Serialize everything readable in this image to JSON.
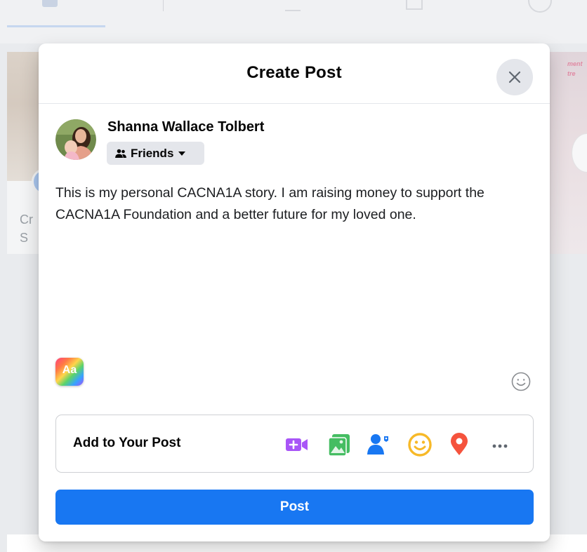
{
  "modal": {
    "title": "Create Post",
    "close_icon": "close-icon"
  },
  "author": {
    "name": "Shanna Wallace Tolbert",
    "avatar_icon": "profile-photo"
  },
  "audience": {
    "label": "Friends",
    "icon": "friends-icon",
    "caret_icon": "caret-down-icon"
  },
  "post": {
    "text": "This is my personal CACNA1A story. I am raising money to support the CACNA1A Foundation and a better future for my loved one.",
    "text_style_label": "Aa",
    "emoji_icon": "smiley-outline-icon"
  },
  "add_to_post": {
    "label": "Add to Your Post",
    "icons": [
      "live-video-icon",
      "photo-video-icon",
      "tag-people-icon",
      "feeling-activity-icon",
      "check-in-location-icon",
      "more-icon"
    ]
  },
  "submit": {
    "label": "Post"
  },
  "background": {
    "story_text": "Cr\nS",
    "story_right_text": "ment\ntre"
  },
  "colors": {
    "brand_blue": "#1877f2",
    "live_video_purple": "#a855f7",
    "photo_green": "#45bd62",
    "tag_blue": "#1877f2",
    "feeling_yellow": "#f7b928",
    "checkin_red": "#f5533d"
  }
}
